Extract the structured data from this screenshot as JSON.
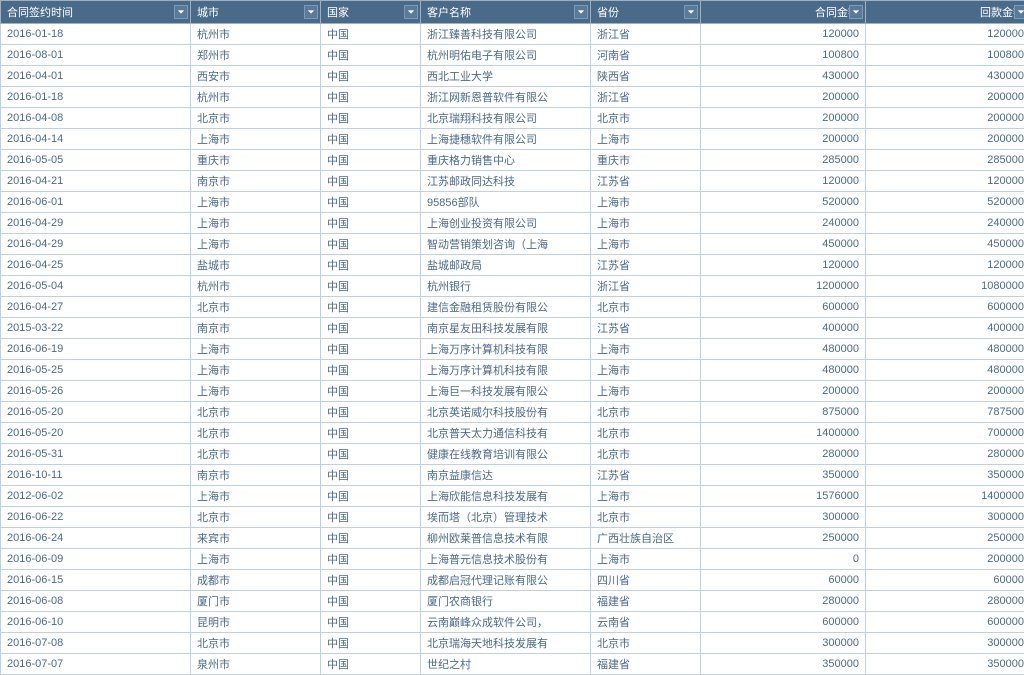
{
  "columns": [
    {
      "key": "date",
      "label": "合同签约时间",
      "cls": "col-date"
    },
    {
      "key": "city",
      "label": "城市",
      "cls": "col-city"
    },
    {
      "key": "country",
      "label": "国家",
      "cls": "col-country"
    },
    {
      "key": "customer",
      "label": "客户名称",
      "cls": "col-customer"
    },
    {
      "key": "province",
      "label": "省份",
      "cls": "col-province"
    },
    {
      "key": "contract",
      "label": "合同金额",
      "cls": "col-contract",
      "num": true
    },
    {
      "key": "payment",
      "label": "回款金额",
      "cls": "col-payment",
      "num": true
    }
  ],
  "rows": [
    {
      "date": "2016-01-18",
      "city": "杭州市",
      "country": "中国",
      "customer": "浙江臻善科技有限公司",
      "province": "浙江省",
      "contract": "120000",
      "payment": "120000"
    },
    {
      "date": "2016-08-01",
      "city": "郑州市",
      "country": "中国",
      "customer": "杭州明佑电子有限公司",
      "province": "河南省",
      "contract": "100800",
      "payment": "100800"
    },
    {
      "date": "2016-04-01",
      "city": "西安市",
      "country": "中国",
      "customer": "西北工业大学",
      "province": "陕西省",
      "contract": "430000",
      "payment": "430000"
    },
    {
      "date": "2016-01-18",
      "city": "杭州市",
      "country": "中国",
      "customer": "浙江网新恩普软件有限公",
      "province": "浙江省",
      "contract": "200000",
      "payment": "200000"
    },
    {
      "date": "2016-04-08",
      "city": "北京市",
      "country": "中国",
      "customer": "北京瑞翔科技有限公司",
      "province": "北京市",
      "contract": "200000",
      "payment": "200000"
    },
    {
      "date": "2016-04-14",
      "city": "上海市",
      "country": "中国",
      "customer": "上海捷穗软件有限公司",
      "province": "上海市",
      "contract": "200000",
      "payment": "200000"
    },
    {
      "date": "2016-05-05",
      "city": "重庆市",
      "country": "中国",
      "customer": "重庆格力销售中心",
      "province": "重庆市",
      "contract": "285000",
      "payment": "285000"
    },
    {
      "date": "2016-04-21",
      "city": "南京市",
      "country": "中国",
      "customer": "江苏邮政同达科技",
      "province": "江苏省",
      "contract": "120000",
      "payment": "120000"
    },
    {
      "date": "2016-06-01",
      "city": "上海市",
      "country": "中国",
      "customer": "95856部队",
      "province": "上海市",
      "contract": "520000",
      "payment": "520000"
    },
    {
      "date": "2016-04-29",
      "city": "上海市",
      "country": "中国",
      "customer": "上海创业投资有限公司",
      "province": "上海市",
      "contract": "240000",
      "payment": "240000"
    },
    {
      "date": "2016-04-29",
      "city": "上海市",
      "country": "中国",
      "customer": "智动营销策划咨询（上海",
      "province": "上海市",
      "contract": "450000",
      "payment": "450000"
    },
    {
      "date": "2016-04-25",
      "city": "盐城市",
      "country": "中国",
      "customer": "盐城邮政局",
      "province": "江苏省",
      "contract": "120000",
      "payment": "120000"
    },
    {
      "date": "2016-05-04",
      "city": "杭州市",
      "country": "中国",
      "customer": "杭州银行",
      "province": "浙江省",
      "contract": "1200000",
      "payment": "1080000"
    },
    {
      "date": "2016-04-27",
      "city": "北京市",
      "country": "中国",
      "customer": "建信金融租赁股份有限公",
      "province": "北京市",
      "contract": "600000",
      "payment": "600000"
    },
    {
      "date": "2015-03-22",
      "city": "南京市",
      "country": "中国",
      "customer": "南京星友田科技发展有限",
      "province": "江苏省",
      "contract": "400000",
      "payment": "400000"
    },
    {
      "date": "2016-06-19",
      "city": "上海市",
      "country": "中国",
      "customer": "上海万序计算机科技有限",
      "province": "上海市",
      "contract": "480000",
      "payment": "480000"
    },
    {
      "date": "2016-05-25",
      "city": "上海市",
      "country": "中国",
      "customer": "上海万序计算机科技有限",
      "province": "上海市",
      "contract": "480000",
      "payment": "480000"
    },
    {
      "date": "2016-05-26",
      "city": "上海市",
      "country": "中国",
      "customer": "上海巨一科技发展有限公",
      "province": "上海市",
      "contract": "200000",
      "payment": "200000"
    },
    {
      "date": "2016-05-20",
      "city": "北京市",
      "country": "中国",
      "customer": "北京英诺威尔科技股份有",
      "province": "北京市",
      "contract": "875000",
      "payment": "787500"
    },
    {
      "date": "2016-05-20",
      "city": "北京市",
      "country": "中国",
      "customer": "北京普天太力通信科技有",
      "province": "北京市",
      "contract": "1400000",
      "payment": "700000"
    },
    {
      "date": "2016-05-31",
      "city": "北京市",
      "country": "中国",
      "customer": "健康在线教育培训有限公",
      "province": "北京市",
      "contract": "280000",
      "payment": "280000"
    },
    {
      "date": "2016-10-11",
      "city": "南京市",
      "country": "中国",
      "customer": "南京益康信达",
      "province": "江苏省",
      "contract": "350000",
      "payment": "350000"
    },
    {
      "date": "2012-06-02",
      "city": "上海市",
      "country": "中国",
      "customer": "上海欣能信息科技发展有",
      "province": "上海市",
      "contract": "1576000",
      "payment": "1400000"
    },
    {
      "date": "2016-06-22",
      "city": "北京市",
      "country": "中国",
      "customer": "埃而塔（北京）管理技术",
      "province": "北京市",
      "contract": "300000",
      "payment": "300000"
    },
    {
      "date": "2016-06-24",
      "city": "来宾市",
      "country": "中国",
      "customer": "柳州欧莱普信息技术有限",
      "province": "广西壮族自治区",
      "contract": "250000",
      "payment": "250000"
    },
    {
      "date": "2016-06-09",
      "city": "上海市",
      "country": "中国",
      "customer": "上海普元信息技术股份有",
      "province": "上海市",
      "contract": "0",
      "payment": "200000"
    },
    {
      "date": "2016-06-15",
      "city": "成都市",
      "country": "中国",
      "customer": "成都启冠代理记账有限公",
      "province": "四川省",
      "contract": "60000",
      "payment": "60000"
    },
    {
      "date": "2016-06-08",
      "city": "厦门市",
      "country": "中国",
      "customer": "厦门农商银行",
      "province": "福建省",
      "contract": "280000",
      "payment": "280000"
    },
    {
      "date": "2016-06-10",
      "city": "昆明市",
      "country": "中国",
      "customer": "云南巅峰众成软件公司，",
      "province": "云南省",
      "contract": "600000",
      "payment": "600000"
    },
    {
      "date": "2016-07-08",
      "city": "北京市",
      "country": "中国",
      "customer": "北京瑞海天地科技发展有",
      "province": "北京市",
      "contract": "300000",
      "payment": "300000"
    },
    {
      "date": "2016-07-07",
      "city": "泉州市",
      "country": "中国",
      "customer": "世纪之村",
      "province": "福建省",
      "contract": "350000",
      "payment": "350000"
    }
  ]
}
